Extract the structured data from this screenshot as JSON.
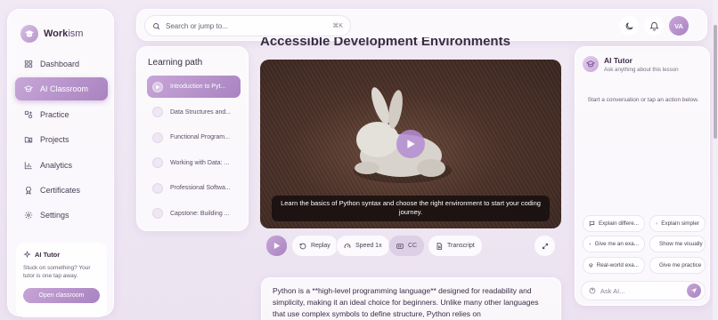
{
  "app": {
    "name_bold": "Work",
    "name_rest": "ism"
  },
  "sidebar": {
    "items": [
      {
        "label": "Dashboard",
        "icon": "dashboard-icon"
      },
      {
        "label": "AI Classroom",
        "icon": "graduation-cap-icon",
        "active": true
      },
      {
        "label": "Practice",
        "icon": "shapes-icon"
      },
      {
        "label": "Projects",
        "icon": "folder-search-icon"
      },
      {
        "label": "Analytics",
        "icon": "bar-chart-icon"
      },
      {
        "label": "Certificates",
        "icon": "award-icon"
      },
      {
        "label": "Settings",
        "icon": "gear-icon"
      }
    ],
    "tutor_card": {
      "title": "AI Tutor",
      "text": "Stuck on something? Your tutor is one tap away.",
      "button": "Open classroom"
    }
  },
  "topbar": {
    "search_placeholder": "Search or jump to...",
    "shortcut": "⌘K",
    "avatar_initials": "VA"
  },
  "page": {
    "title": "Accessible Development Environments"
  },
  "learning_path": {
    "title": "Learning path",
    "items": [
      {
        "label": "Introduction to Pyt...",
        "active": true
      },
      {
        "label": "Data Structures and..."
      },
      {
        "label": "Functional Program..."
      },
      {
        "label": "Working with Data: ..."
      },
      {
        "label": "Professional Softwa..."
      },
      {
        "label": "Capstone: Building ..."
      }
    ]
  },
  "video": {
    "caption": "Learn the basics of Python syntax and choose the right environment to start your coding journey."
  },
  "controls": {
    "replay": "Replay",
    "speed": "Speed 1x",
    "cc": "CC",
    "transcript": "Transcript"
  },
  "description": {
    "text": "Python is a **high-level programming language** designed for readability and simplicity, making it an ideal choice for beginners. Unlike many other languages that use complex symbols to define structure, Python relies on"
  },
  "tutor_panel": {
    "title": "AI Tutor",
    "subtitle": "Ask anything about this lesson",
    "empty_text": "Start a conversation or tap an action below.",
    "chips": [
      "Explain differe...",
      "Explain simpler",
      "Give me an exa...",
      "Show me visually",
      "Real-world exa...",
      "Give me practice"
    ],
    "ask_placeholder": "Ask AI..."
  },
  "colors": {
    "accent": "#a983c0",
    "accent_light": "#c7a6d8",
    "background": "#efe7f3"
  }
}
